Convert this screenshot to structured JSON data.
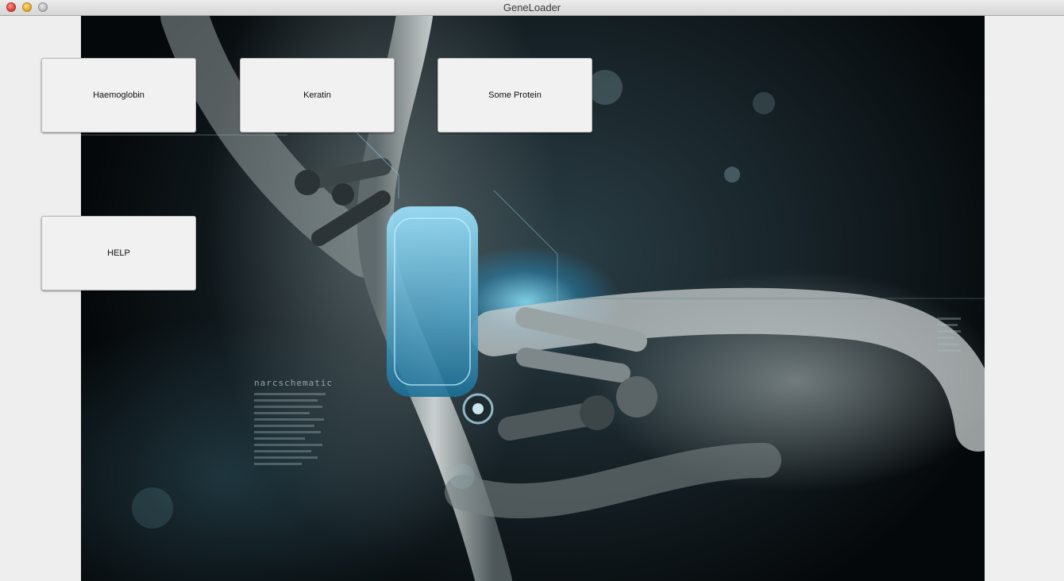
{
  "window": {
    "title": "GeneLoader"
  },
  "buttons": {
    "haemoglobin": "Haemoglobin",
    "keratin": "Keratin",
    "some_protein": "Some Protein",
    "help": "HELP"
  },
  "background": {
    "watermark": "narcschematic"
  },
  "colors": {
    "accent_glow": "#49b6e6",
    "background_dark": "#10191d",
    "button_face": "#f1f1f1"
  }
}
